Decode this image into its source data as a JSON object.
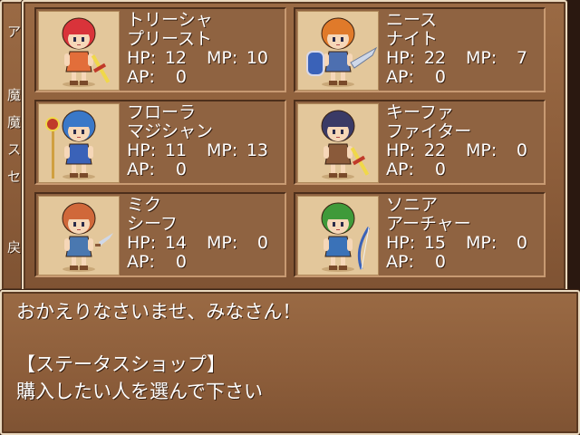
{
  "left_menu": {
    "glyphs": [
      "ア",
      "魔",
      "魔",
      "ス",
      "セ",
      "戻"
    ]
  },
  "party": [
    {
      "name": "トリーシャ",
      "class": "プリースト",
      "hp": "12",
      "mp": "10",
      "ap": "0",
      "hair": "#d9333a",
      "outfit": "#e26e3a",
      "weapon": "sword"
    },
    {
      "name": "ニース",
      "class": "ナイト",
      "hp": "22",
      "mp": "7",
      "ap": "0",
      "hair": "#e07a2a",
      "outfit": "#4d6fb0",
      "weapon": "spear"
    },
    {
      "name": "フローラ",
      "class": "マジシャン",
      "hp": "11",
      "mp": "13",
      "ap": "0",
      "hair": "#3a78c8",
      "outfit": "#3a62b8",
      "weapon": "staff"
    },
    {
      "name": "キーファ",
      "class": "ファイター",
      "hp": "22",
      "mp": "0",
      "ap": "0",
      "hair": "#3a3a66",
      "outfit": "#8a5a3a",
      "weapon": "sword"
    },
    {
      "name": "ミク",
      "class": "シーフ",
      "hp": "14",
      "mp": "0",
      "ap": "0",
      "hair": "#d0683a",
      "outfit": "#4a78b0",
      "weapon": "dagger"
    },
    {
      "name": "ソニア",
      "class": "アーチャー",
      "hp": "15",
      "mp": "0",
      "ap": "0",
      "hair": "#3f9a3a",
      "outfit": "#3a72b8",
      "weapon": "bow"
    }
  ],
  "labels": {
    "hp": "HP:",
    "mp": "MP:",
    "ap": "AP:"
  },
  "message": {
    "line1": "おかえりなさいませ、みなさん！",
    "line2": "",
    "line3": "【ステータスショップ】",
    "line4": "購入したい人を選んで下さい"
  },
  "colors": {
    "window": "#8c5d3a",
    "border": "#ead9bf",
    "portrait_bg": "#e3c79b",
    "text": "#ffffff"
  }
}
